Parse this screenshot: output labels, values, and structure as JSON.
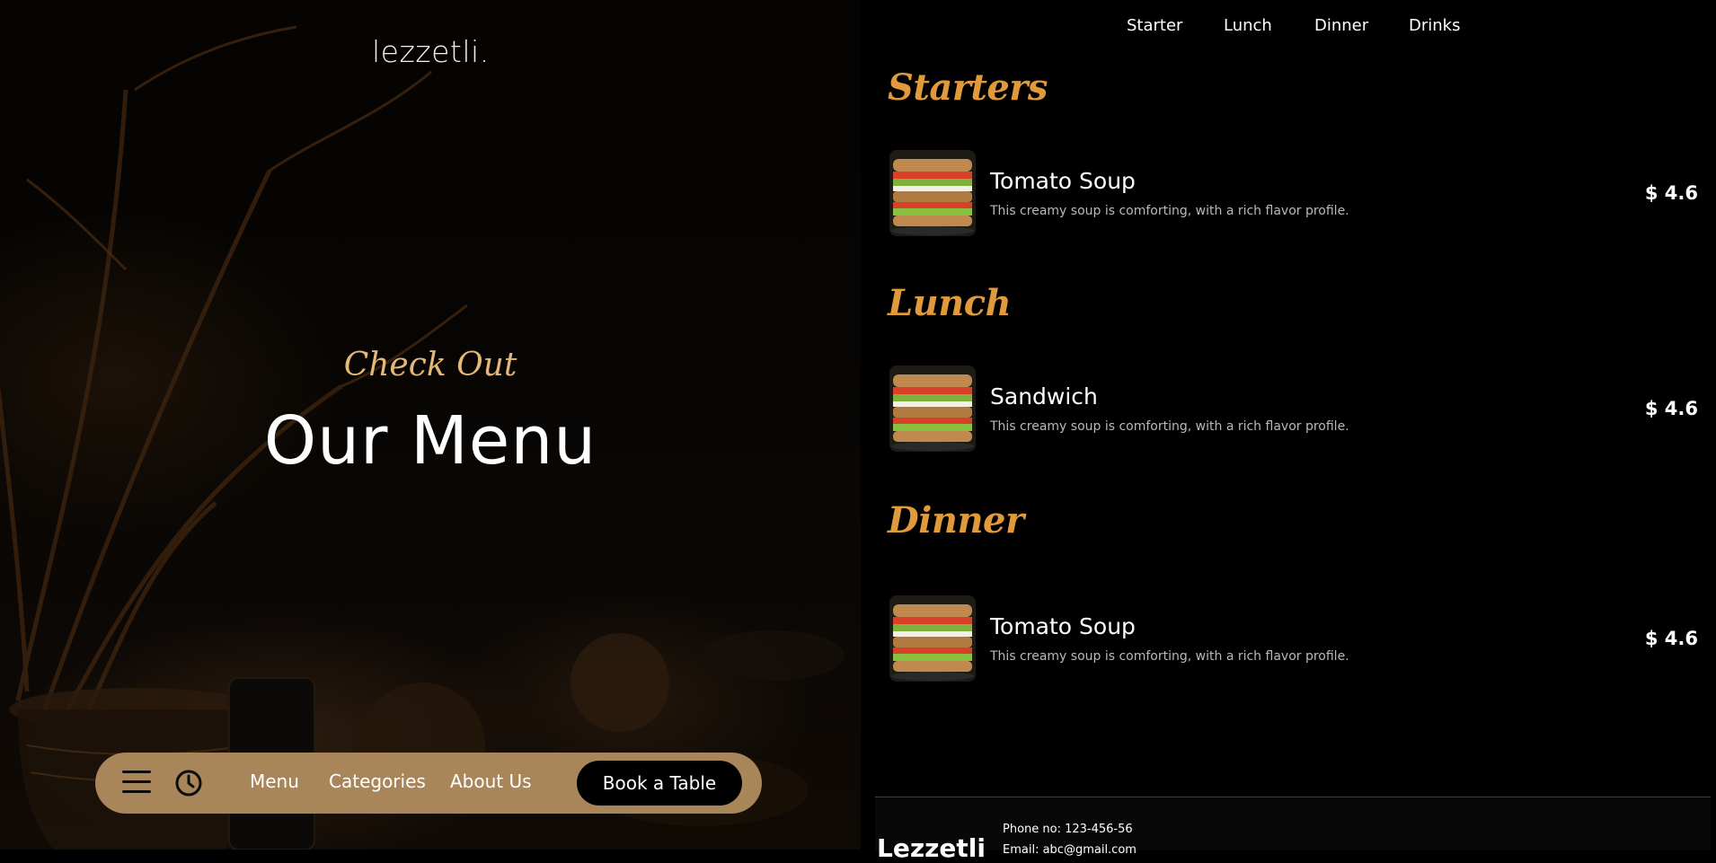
{
  "brand": "lezzetli.",
  "hero": {
    "subtitle": "Check Out",
    "title": "Our Menu"
  },
  "bottom_nav": {
    "icons": [
      "hamburger-menu-icon",
      "clock-icon"
    ],
    "links": [
      "Menu",
      "Categories",
      "About Us"
    ],
    "cta": "Book a Table",
    "background": "#a8865a"
  },
  "top_nav": [
    "Starter",
    "Lunch",
    "Dinner",
    "Drinks"
  ],
  "sections": [
    {
      "title": "Starters",
      "items": [
        {
          "name": "Tomato Soup",
          "description": "This creamy soup is comforting, with a rich flavor profile.",
          "price": "$ 4.6"
        }
      ]
    },
    {
      "title": "Lunch",
      "items": [
        {
          "name": "Sandwich",
          "description": "This creamy soup is comforting, with a rich flavor profile.",
          "price": "$ 4.6"
        }
      ]
    },
    {
      "title": "Dinner",
      "items": [
        {
          "name": "Tomato Soup",
          "description": "This creamy soup is comforting, with a rich flavor profile.",
          "price": "$ 4.6"
        }
      ]
    }
  ],
  "footer": {
    "logo": "Lezzetli",
    "phone": "Phone no: 123-456-56",
    "email": "Email: abc@gmail.com"
  },
  "colors": {
    "accent": "#e09a3c",
    "hero_subtitle": "#e6b877",
    "background": "#000000"
  }
}
